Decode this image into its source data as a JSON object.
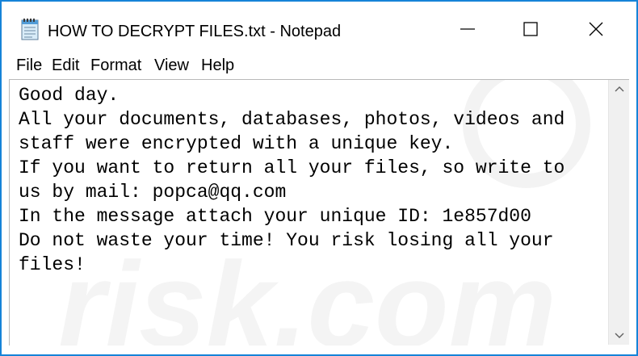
{
  "window": {
    "title": "HOW TO DECRYPT FILES.txt - Notepad",
    "app_icon": "notepad-icon",
    "accent_color": "#1683d8"
  },
  "menu": {
    "file": "File",
    "edit": "Edit",
    "format": "Format",
    "view": "View",
    "help": "Help"
  },
  "document": {
    "lines": [
      "Good day.",
      "All your documents, databases, photos, videos and",
      "staff were encrypted with a unique key.",
      "If you want to return all your files, so write to",
      "us by mail: popca@qq.com",
      "In the message attach your unique ID: 1e857d00",
      "Do not waste your time! You risk losing all your",
      "files!"
    ]
  },
  "watermark_text": "risk.com"
}
